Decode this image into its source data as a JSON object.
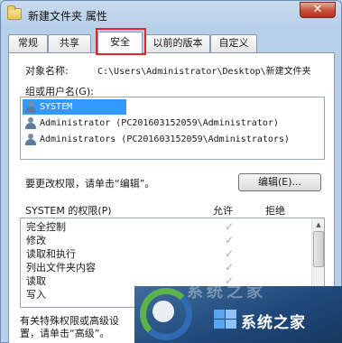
{
  "window": {
    "title": "新建文件夹 属性",
    "close_symbol": "✕"
  },
  "tabs": [
    {
      "label": "常规"
    },
    {
      "label": "共享"
    },
    {
      "label": "安全"
    },
    {
      "label": "以前的版本"
    },
    {
      "label": "自定义"
    }
  ],
  "security": {
    "object_label": "对象名称:",
    "object_path": "C:\\Users\\Administrator\\Desktop\\新建文件夹",
    "groups_label": "组或用户名(G):",
    "users": [
      {
        "name": "SYSTEM"
      },
      {
        "name": "Administrator (PC201603152059\\Administrator)"
      },
      {
        "name": "Administrators (PC201603152059\\Administrators)"
      }
    ],
    "change_hint": "要更改权限，请单击“编辑”。",
    "edit_button": "编辑(E)...",
    "permissions_for": "SYSTEM 的权限(P)",
    "allow_header": "允许",
    "deny_header": "拒绝",
    "permissions": [
      {
        "name": "完全控制",
        "allow": "✓"
      },
      {
        "name": "修改",
        "allow": "✓"
      },
      {
        "name": "读取和执行",
        "allow": "✓"
      },
      {
        "name": "列出文件夹内容",
        "allow": "✓"
      },
      {
        "name": "读取",
        "allow": "✓"
      },
      {
        "name": "写入",
        "allow": "✓"
      }
    ],
    "special_text": "有关特殊权限或高级设置，请单击“高级”。"
  },
  "watermark": {
    "text": "系统之家",
    "ghost_text": "系统之家"
  },
  "colors": {
    "selection": "#3399ff",
    "highlight_box": "#e0262b",
    "close_button": "#c9553e"
  }
}
